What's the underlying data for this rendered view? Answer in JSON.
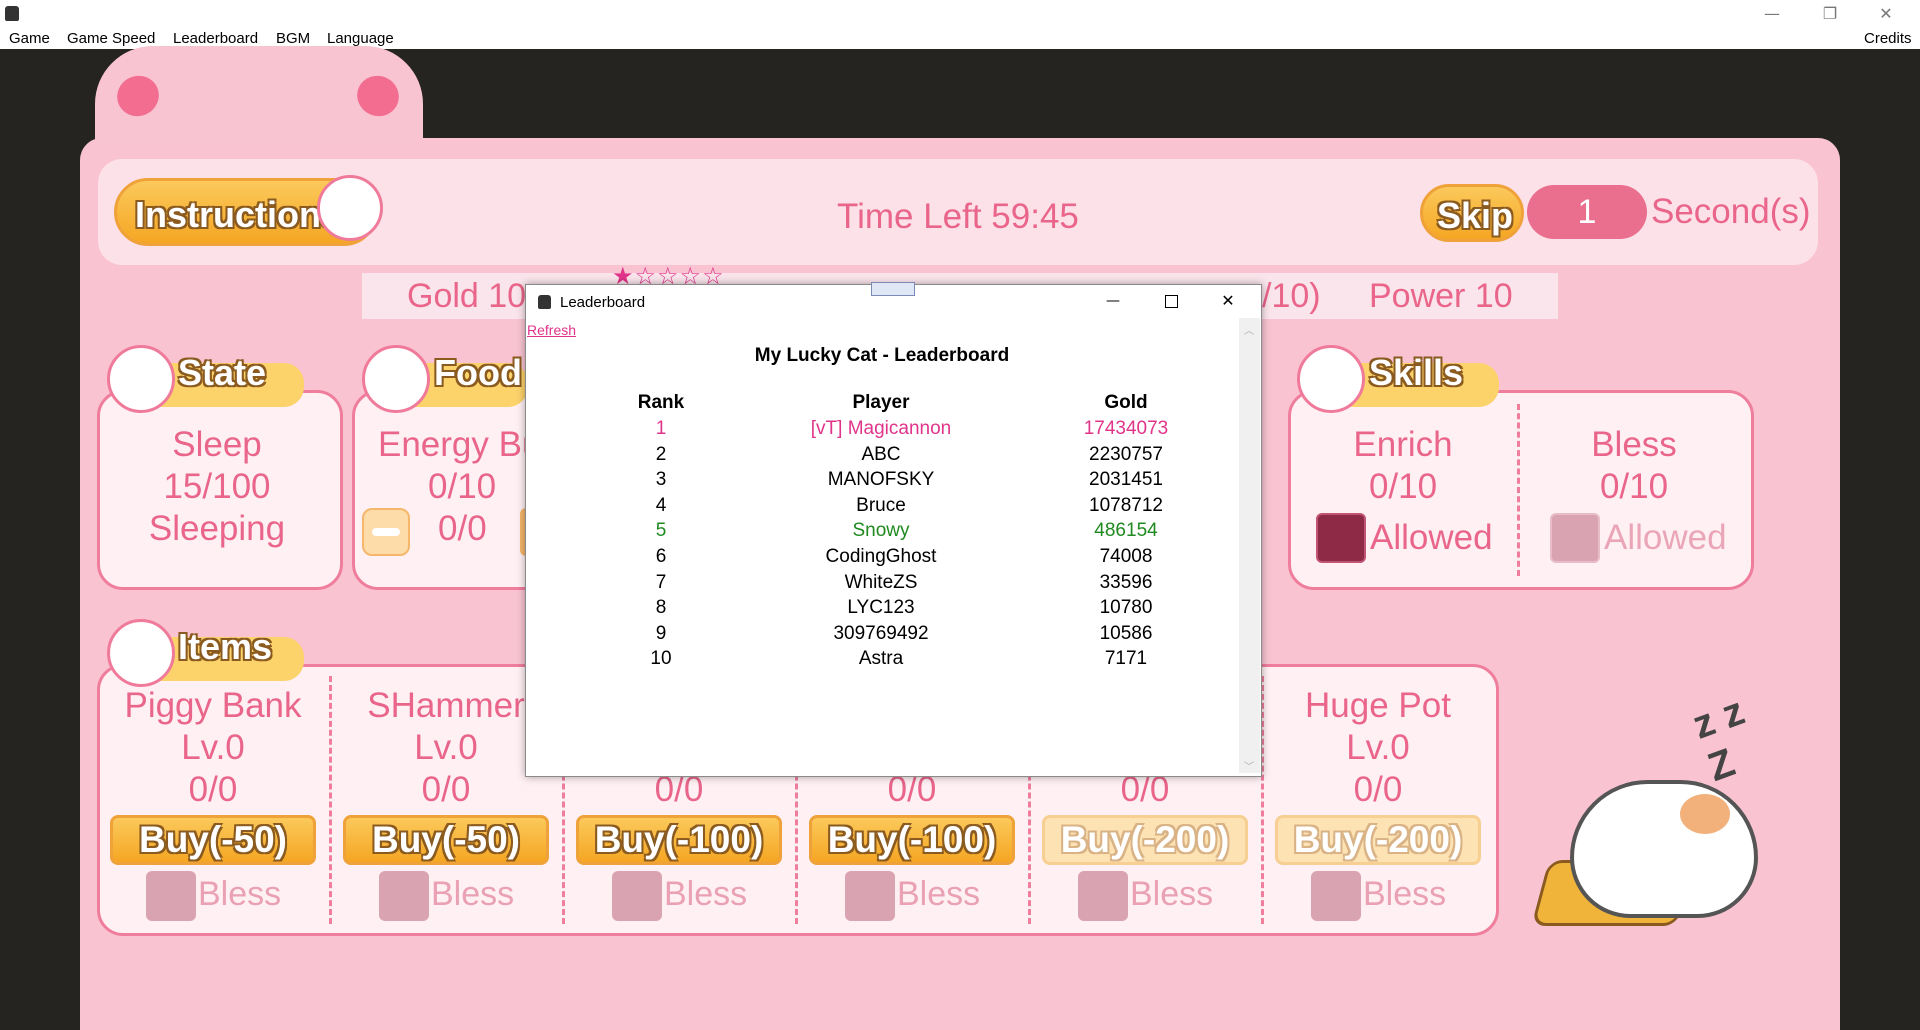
{
  "menu": {
    "items": [
      "Game",
      "Game Speed",
      "Leaderboard",
      "BGM",
      "Language"
    ],
    "credits": "Credits"
  },
  "window_controls": {
    "minimize": "—",
    "restore": "❐",
    "close": "✕"
  },
  "top": {
    "instructions": "Instructions",
    "time_left": "Time Left 59:45",
    "skip": "Skip",
    "skip_value": "1",
    "seconds": "Second(s)"
  },
  "stats": {
    "gold": "Gold 10",
    "stars": "★☆☆☆☆",
    "partial": "/10)",
    "power": "Power 10"
  },
  "state": {
    "title": "State",
    "line1": "Sleep",
    "line2": "15/100",
    "line3": "Sleeping"
  },
  "food": {
    "title": "Food",
    "line1": "Energy Bu",
    "line2": "0/10",
    "line3": "0/0"
  },
  "skills": {
    "title": "Skills",
    "enrich": {
      "name": "Enrich",
      "count": "0/10",
      "status": "Allowed"
    },
    "bless": {
      "name": "Bless",
      "count": "0/10",
      "status": "Allowed"
    }
  },
  "items": {
    "title": "Items",
    "list": [
      {
        "name": "Piggy Bank",
        "level": "Lv.0",
        "count": "0/0",
        "buy": "Buy(-50)",
        "bless": "Bless"
      },
      {
        "name": "SHammer",
        "level": "Lv.0",
        "count": "0/0",
        "buy": "Buy(-50)",
        "bless": "Bless"
      },
      {
        "name": "",
        "level": "",
        "count": "0/0",
        "buy": "Buy(-100)",
        "bless": "Bless"
      },
      {
        "name": "",
        "level": "",
        "count": "0/0",
        "buy": "Buy(-100)",
        "bless": "Bless"
      },
      {
        "name": "",
        "level": "",
        "count": "0/0",
        "buy": "Buy(-200)",
        "bless": "Bless"
      },
      {
        "name": "Huge Pot",
        "level": "Lv.0",
        "count": "0/0",
        "buy": "Buy(-200)",
        "bless": "Bless"
      }
    ]
  },
  "cat": {
    "zzz": "z z Z"
  },
  "leaderboard": {
    "window_title": "Leaderboard",
    "refresh": "Refresh",
    "heading": "My Lucky Cat - Leaderboard",
    "columns": [
      "Rank",
      "Player",
      "Gold"
    ],
    "rows": [
      {
        "rank": "1",
        "player": "[vT] Magicannon",
        "gold": "17434073",
        "color": "#e0348a"
      },
      {
        "rank": "2",
        "player": "ABC",
        "gold": "2230757",
        "color": "#000000"
      },
      {
        "rank": "3",
        "player": "MANOFSKY",
        "gold": "2031451",
        "color": "#000000"
      },
      {
        "rank": "4",
        "player": "Bruce",
        "gold": "1078712",
        "color": "#000000"
      },
      {
        "rank": "5",
        "player": "Snowy",
        "gold": "486154",
        "color": "#1f8a1f"
      },
      {
        "rank": "6",
        "player": "CodingGhost",
        "gold": "74008",
        "color": "#000000"
      },
      {
        "rank": "7",
        "player": "WhiteZS",
        "gold": "33596",
        "color": "#000000"
      },
      {
        "rank": "8",
        "player": "LYC123",
        "gold": "10780",
        "color": "#000000"
      },
      {
        "rank": "9",
        "player": "309769492",
        "gold": "10586",
        "color": "#000000"
      },
      {
        "rank": "10",
        "player": "Astra",
        "gold": "7171",
        "color": "#000000"
      }
    ]
  }
}
